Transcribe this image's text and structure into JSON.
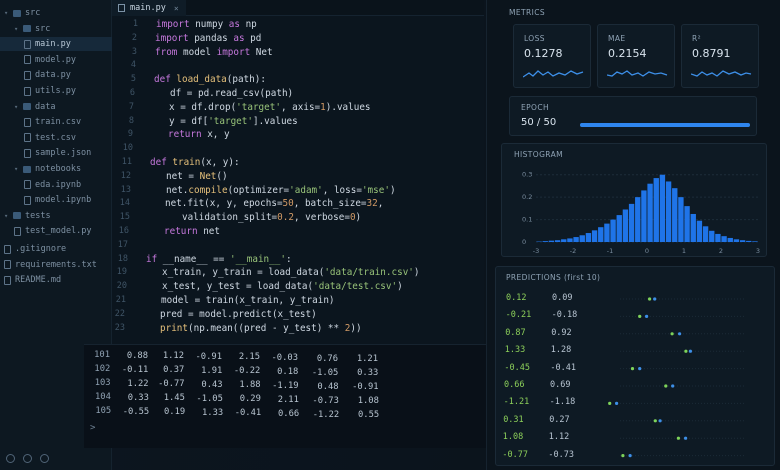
{
  "sidebar": {
    "items": [
      {
        "label": "src",
        "kind": "folder",
        "depth": 0
      },
      {
        "label": "src",
        "kind": "folder",
        "depth": 1
      },
      {
        "label": "main.py",
        "kind": "file",
        "depth": 2,
        "selected": true
      },
      {
        "label": "model.py",
        "kind": "file",
        "depth": 2
      },
      {
        "label": "data.py",
        "kind": "file",
        "depth": 2
      },
      {
        "label": "utils.py",
        "kind": "file",
        "depth": 2
      },
      {
        "label": "data",
        "kind": "folder",
        "depth": 1
      },
      {
        "label": "train.csv",
        "kind": "file",
        "depth": 2
      },
      {
        "label": "test.csv",
        "kind": "file",
        "depth": 2
      },
      {
        "label": "sample.json",
        "kind": "file",
        "depth": 2
      },
      {
        "label": "notebooks",
        "kind": "folder",
        "depth": 1
      },
      {
        "label": "eda.ipynb",
        "kind": "file",
        "depth": 2
      },
      {
        "label": "model.ipynb",
        "kind": "file",
        "depth": 2
      },
      {
        "label": "tests",
        "kind": "folder",
        "depth": 0
      },
      {
        "label": "test_model.py",
        "kind": "file",
        "depth": 1
      },
      {
        "label": ".gitignore",
        "kind": "file",
        "depth": 0
      },
      {
        "label": "requirements.txt",
        "kind": "file",
        "depth": 0
      },
      {
        "label": "README.md",
        "kind": "file",
        "depth": 0
      }
    ]
  },
  "editor": {
    "tab_label": "main.py",
    "lines": [
      {
        "n": "1",
        "indent": 0,
        "parts": [
          [
            "kw",
            "import "
          ],
          [
            "tx",
            "numpy "
          ],
          [
            "kw",
            "as "
          ],
          [
            "tx",
            "np"
          ]
        ]
      },
      {
        "n": "2",
        "indent": 0,
        "parts": [
          [
            "kw",
            "import "
          ],
          [
            "tx",
            "pandas "
          ],
          [
            "kw",
            "as "
          ],
          [
            "tx",
            "pd"
          ]
        ]
      },
      {
        "n": "3",
        "indent": 0,
        "parts": [
          [
            "kw",
            "from "
          ],
          [
            "tx",
            "model "
          ],
          [
            "kw",
            "import "
          ],
          [
            "tx",
            "Net"
          ]
        ]
      },
      {
        "n": "4",
        "indent": 0,
        "parts": []
      },
      {
        "n": "5",
        "indent": 0,
        "parts": [
          [
            "kw",
            "def "
          ],
          [
            "fn",
            "load_data"
          ],
          [
            "tx",
            "(path):"
          ]
        ]
      },
      {
        "n": "6",
        "indent": 1,
        "parts": [
          [
            "tx",
            "df = pd.read_csv(path)"
          ]
        ]
      },
      {
        "n": "7",
        "indent": 1,
        "parts": [
          [
            "tx",
            "x = df.drop("
          ],
          [
            "st",
            "'target'"
          ],
          [
            "tx",
            ", axis="
          ],
          [
            "nm",
            "1"
          ],
          [
            "tx",
            ").values"
          ]
        ]
      },
      {
        "n": "8",
        "indent": 1,
        "parts": [
          [
            "tx",
            "y = df["
          ],
          [
            "st",
            "'target'"
          ],
          [
            "tx",
            "].values"
          ]
        ]
      },
      {
        "n": "9",
        "indent": 1,
        "parts": [
          [
            "kw",
            "return "
          ],
          [
            "tx",
            "x, y"
          ]
        ]
      },
      {
        "n": "10",
        "indent": 0,
        "parts": []
      },
      {
        "n": "11",
        "indent": 0,
        "parts": [
          [
            "kw",
            "def "
          ],
          [
            "fn",
            "train"
          ],
          [
            "tx",
            "(x, y):"
          ]
        ]
      },
      {
        "n": "12",
        "indent": 1,
        "parts": [
          [
            "tx",
            "net = "
          ],
          [
            "fn",
            "Net"
          ],
          [
            "tx",
            "()"
          ]
        ]
      },
      {
        "n": "13",
        "indent": 1,
        "parts": [
          [
            "tx",
            "net."
          ],
          [
            "fn",
            "compile"
          ],
          [
            "tx",
            "(optimizer="
          ],
          [
            "st",
            "'adam'"
          ],
          [
            "tx",
            ", loss="
          ],
          [
            "st",
            "'mse'"
          ],
          [
            "tx",
            ")"
          ]
        ]
      },
      {
        "n": "14",
        "indent": 1,
        "parts": [
          [
            "tx",
            "net.fit(x, y, epochs="
          ],
          [
            "nm",
            "50"
          ],
          [
            "tx",
            ", batch_size="
          ],
          [
            "nm",
            "32"
          ],
          [
            "tx",
            ","
          ]
        ]
      },
      {
        "n": "15",
        "indent": 2,
        "parts": [
          [
            "tx",
            "validation_split="
          ],
          [
            "nm",
            "0.2"
          ],
          [
            "tx",
            ", verbose="
          ],
          [
            "nm",
            "0"
          ],
          [
            "tx",
            ")"
          ]
        ]
      },
      {
        "n": "16",
        "indent": 1,
        "parts": [
          [
            "kw",
            "return "
          ],
          [
            "tx",
            "net"
          ]
        ]
      },
      {
        "n": "17",
        "indent": 0,
        "parts": []
      },
      {
        "n": "18",
        "indent": 0,
        "parts": [
          [
            "kw",
            "if "
          ],
          [
            "tx",
            "__name__ == "
          ],
          [
            "st",
            "'__main__'"
          ],
          [
            "tx",
            ":"
          ]
        ]
      },
      {
        "n": "19",
        "indent": 1,
        "parts": [
          [
            "tx",
            "x_train, y_train = load_data("
          ],
          [
            "st",
            "'data/train.csv'"
          ],
          [
            "tx",
            ")"
          ]
        ]
      },
      {
        "n": "20",
        "indent": 1,
        "parts": [
          [
            "tx",
            "x_test, y_test = load_data("
          ],
          [
            "st",
            "'data/test.csv'"
          ],
          [
            "tx",
            ")"
          ]
        ]
      },
      {
        "n": "21",
        "indent": 1,
        "parts": [
          [
            "tx",
            "model = train(x_train, y_train)"
          ]
        ]
      },
      {
        "n": "22",
        "indent": 1,
        "parts": [
          [
            "tx",
            "pred = model.predict(x_test)"
          ]
        ]
      },
      {
        "n": "23",
        "indent": 1,
        "parts": [
          [
            "fn",
            "print"
          ],
          [
            "tx",
            "(np.mean((pred - y_test) ** "
          ],
          [
            "nm",
            "2"
          ],
          [
            "tx",
            "))"
          ]
        ]
      }
    ]
  },
  "terminal": {
    "rows": [
      [
        "101",
        "0.88",
        "1.12",
        "-0.91",
        "2.15",
        "-0.03",
        "0.76",
        "1.21"
      ],
      [
        "102",
        "-0.11",
        "0.37",
        "1.91",
        "-0.22",
        "0.18",
        "-1.05",
        "0.33"
      ],
      [
        "103",
        "1.22",
        "-0.77",
        "0.43",
        "1.88",
        "-1.19",
        "0.48",
        "-0.91"
      ],
      [
        "104",
        "0.33",
        "1.45",
        "-1.05",
        "0.29",
        "2.11",
        "-0.73",
        "1.08"
      ],
      [
        "105",
        "-0.55",
        "0.19",
        "1.33",
        "-0.41",
        "0.66",
        "-1.22",
        "0.55"
      ]
    ],
    "prompt": ">"
  },
  "metrics": {
    "title": "METRICS",
    "cards": [
      {
        "label": "LOSS",
        "value": "0.1278"
      },
      {
        "label": "MAE",
        "value": "0.2154"
      },
      {
        "label": "R²",
        "value": "0.8791"
      }
    ],
    "epoch_label": "EPOCH",
    "epoch_value": "50 / 50",
    "epoch_progress": 1.0,
    "accent": "#2f86ee"
  },
  "histogram": {
    "title": "HISTOGRAM",
    "y_ticks": [
      "0.3",
      "0.2",
      "0.1",
      "0"
    ],
    "x_ticks": [
      "-3",
      "-2",
      "-1",
      "0",
      "1",
      "2",
      "3"
    ],
    "bins": [
      0.002,
      0.004,
      0.006,
      0.008,
      0.012,
      0.016,
      0.022,
      0.03,
      0.04,
      0.052,
      0.066,
      0.082,
      0.1,
      0.12,
      0.145,
      0.17,
      0.2,
      0.23,
      0.26,
      0.285,
      0.3,
      0.27,
      0.24,
      0.2,
      0.16,
      0.125,
      0.095,
      0.07,
      0.05,
      0.036,
      0.026,
      0.018,
      0.012,
      0.008,
      0.005,
      0.003
    ],
    "x_range": [
      -3,
      3
    ],
    "y_range": [
      0,
      0.33
    ]
  },
  "predictions": {
    "title": "PREDICTIONS (first 10)",
    "rows": [
      [
        "0.12",
        "0.09"
      ],
      [
        "-0.21",
        "-0.18"
      ],
      [
        "0.87",
        "0.92"
      ],
      [
        "1.33",
        "1.28"
      ],
      [
        "-0.45",
        "-0.41"
      ],
      [
        "0.66",
        "0.69"
      ],
      [
        "-1.21",
        "-1.18"
      ],
      [
        "0.31",
        "0.27"
      ],
      [
        "1.08",
        "1.12"
      ],
      [
        "-0.77",
        "-0.73"
      ]
    ]
  }
}
